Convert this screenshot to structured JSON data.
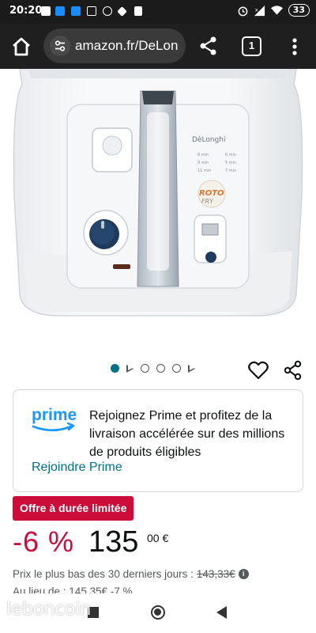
{
  "status_bar": {
    "time": "20:20",
    "battery": "33",
    "icons": [
      "signal-icon",
      "notification-icons",
      "mute-icon",
      "alarm-icon",
      "cellular-icon",
      "wifi-icon"
    ]
  },
  "browser": {
    "url": "amazon.fr/DeLon",
    "tab_count": "1"
  },
  "product_image": {
    "brand_label": "DèLonghi",
    "product_logo_top": "ROTO",
    "product_logo_bottom": "FRY"
  },
  "carousel": {
    "items": [
      "image",
      "video",
      "image",
      "image",
      "image",
      "video"
    ],
    "active_index": 0
  },
  "prime": {
    "logo_text": "prime",
    "message": "Rejoignez Prime et profitez de la livraison accélérée sur des millions de produits éligibles",
    "link": "Rejoindre Prime"
  },
  "deal": {
    "badge": "Offre à durée limitée",
    "discount": "-6 %",
    "price_whole": "135",
    "price_fraction": "00 €"
  },
  "lowest_price": {
    "label": "Prix le plus bas des 30 derniers jours :",
    "value": "143,33€",
    "info": "i"
  },
  "cut_text": "Au lieu de : 145,35€ -7 %",
  "watermark": "leboncoin",
  "colors": {
    "accent_link": "#007185",
    "deal_red": "#cc0c39",
    "prime_blue": "#1a98ff",
    "browser_bar": "#1f1f1f"
  }
}
